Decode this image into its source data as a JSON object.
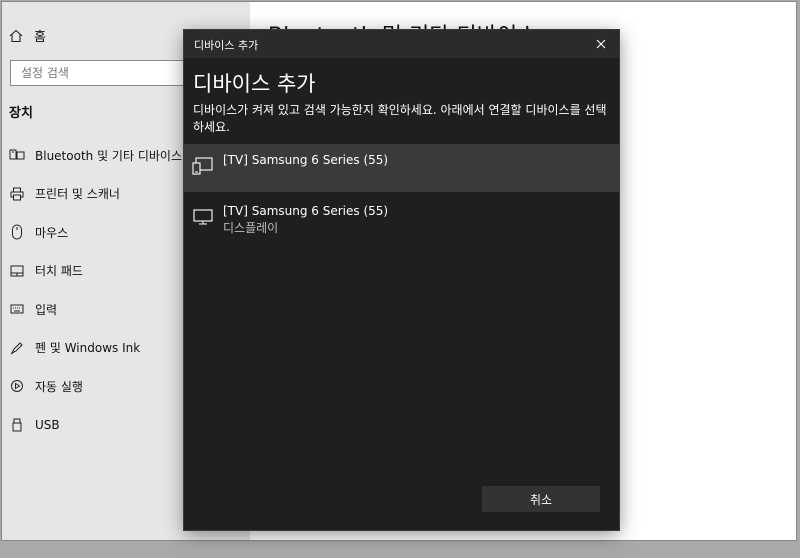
{
  "sidebar": {
    "home_label": "홈",
    "search_placeholder": "설정 검색",
    "section_title": "장치",
    "items": [
      {
        "label": "Bluetooth 및 기타 디바이스",
        "icon": "bluetooth-devices-icon"
      },
      {
        "label": "프린터 및 스캐너",
        "icon": "printer-icon"
      },
      {
        "label": "마우스",
        "icon": "mouse-icon"
      },
      {
        "label": "터치 패드",
        "icon": "touchpad-icon"
      },
      {
        "label": "입력",
        "icon": "keyboard-icon"
      },
      {
        "label": "펜 및 Windows Ink",
        "icon": "pen-icon"
      },
      {
        "label": "자동 실행",
        "icon": "autoplay-icon"
      },
      {
        "label": "USB",
        "icon": "usb-icon"
      }
    ]
  },
  "main": {
    "title": "Bluetooth 및 기타 디바이스"
  },
  "dialog": {
    "window_title": "디바이스 추가",
    "heading": "디바이스 추가",
    "description": "디바이스가 켜져 있고 검색 가능한지 확인하세요. 아래에서 연결할 디바이스를 선택하세요.",
    "devices": [
      {
        "name": "[TV] Samsung 6 Series (55)",
        "subtitle": "",
        "icon": "cast-device-icon",
        "selected": true
      },
      {
        "name": "[TV] Samsung 6 Series (55)",
        "subtitle": "디스플레이",
        "icon": "monitor-icon",
        "selected": false
      }
    ],
    "cancel_label": "취소"
  },
  "colors": {
    "dialog_bg": "#1f1f1f",
    "selected_row": "#3a3a3a",
    "sidebar_bg": "#e6e6e6",
    "button_bg": "#333333"
  }
}
